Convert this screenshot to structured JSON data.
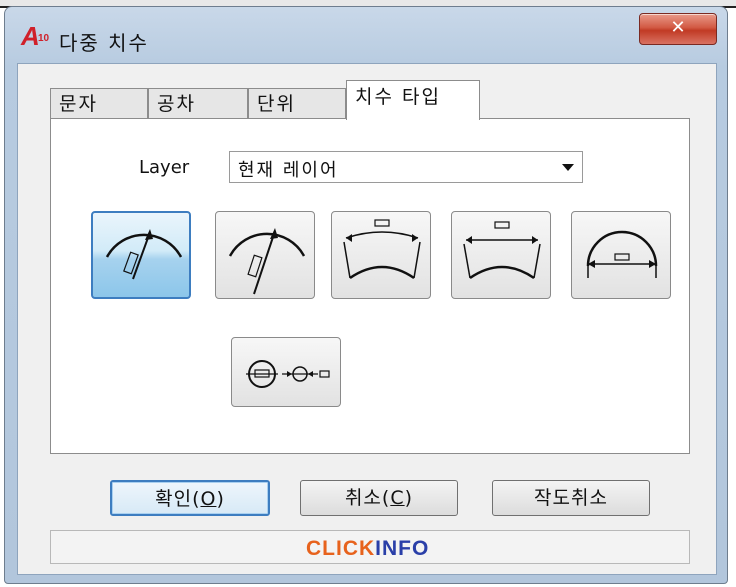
{
  "window": {
    "title": "다중 치수",
    "app_icon_letter": "A",
    "app_icon_num": "10",
    "close_glyph": "✕"
  },
  "tabs": [
    {
      "label": "문자",
      "active": false
    },
    {
      "label": "공차",
      "active": false
    },
    {
      "label": "단위",
      "active": false
    },
    {
      "label": "치수 타입",
      "active": true
    }
  ],
  "layer": {
    "label": "Layer",
    "selected_value": "현재 레이어"
  },
  "dimension_types": [
    {
      "icon": "arc-radius-dim-icon",
      "selected": true
    },
    {
      "icon": "arc-radius-extended-dim-icon",
      "selected": false
    },
    {
      "icon": "arc-length-dim-icon",
      "selected": false
    },
    {
      "icon": "arc-chord-dim-icon",
      "selected": false
    },
    {
      "icon": "arc-diameter-dim-icon",
      "selected": false
    },
    {
      "icon": "circle-diameter-dim-icon",
      "selected": false
    }
  ],
  "buttons": {
    "ok_text": "확인(",
    "ok_mnemonic": "O",
    "ok_end": ")",
    "cancel_text": "취소(",
    "cancel_mnemonic": "C",
    "cancel_end": ")",
    "undo_label": "작도취소"
  },
  "status": {
    "brand_part1": "CLICK",
    "brand_part2": "INFO"
  },
  "colors": {
    "accent": "#3d7dc0",
    "close_button": "#c13a24",
    "brand_orange": "#e7621c",
    "brand_blue": "#2a3fa8"
  }
}
